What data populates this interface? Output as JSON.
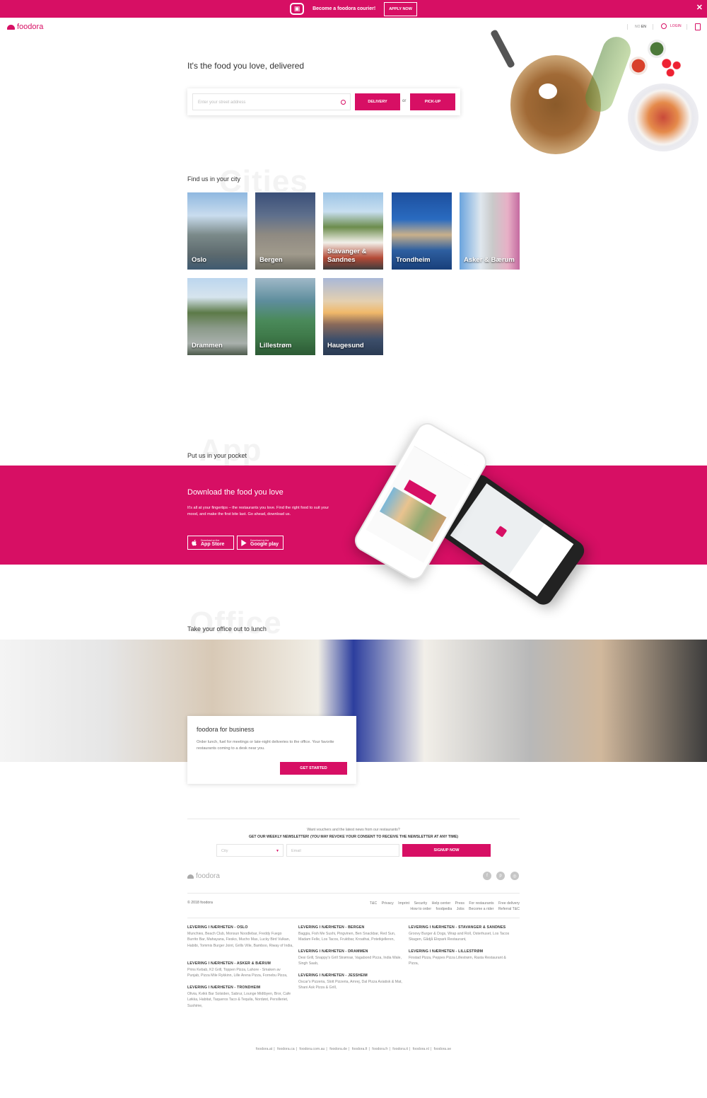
{
  "banner": {
    "text": "Become a foodora courier!",
    "apply_label": "APPLY NOW",
    "close_symbol": "✕"
  },
  "header": {
    "logo": "foodora",
    "lang_no": "NO",
    "lang_en": "EN",
    "login": "LOGIN"
  },
  "hero": {
    "title": "It's the food you love, delivered",
    "address_placeholder": "Enter your street address",
    "delivery_label": "DELIVERY",
    "or_label": "or",
    "pickup_label": "PICK-UP"
  },
  "cities": {
    "bg_word": "Cities",
    "title": "Find us in your city",
    "items": [
      {
        "name": "Oslo"
      },
      {
        "name": "Bergen"
      },
      {
        "name": "Stavanger & Sandnes"
      },
      {
        "name": "Trondheim"
      },
      {
        "name": "Asker & Bærum"
      },
      {
        "name": "Drammen"
      },
      {
        "name": "Lillestrøm"
      },
      {
        "name": "Haugesund"
      }
    ]
  },
  "app": {
    "bg_word": "App",
    "title": "Put us in your pocket",
    "headline": "Download the food you love",
    "description": "It's all at your fingertips – the restaurants you love. Find the right food to suit your mood, and make the first bite last. Go ahead, download us.",
    "appstore_small": "Download on the",
    "appstore_big": "App Store",
    "googleplay_small": "Download on the",
    "googleplay_big": "Google play"
  },
  "office": {
    "bg_word": "Office",
    "title": "Take your office out to lunch",
    "card_title": "foodora for business",
    "card_desc": "Order lunch, fuel for meetings or late-night deliveries to the office. Your favorite restaurants coming to a desk near you.",
    "card_button": "GET STARTED"
  },
  "newsletter": {
    "question": "Want vouchers and the latest news from our restaurants?",
    "headline": "GET OUR WEEKLY NEWSLETTER! (YOU MAY REVOKE YOUR CONSENT TO RECEIVE THE NEWSLETTER AT ANY TIME)",
    "city_placeholder": "City",
    "email_placeholder": "Email",
    "signup_label": "SIGNUP NOW"
  },
  "footer": {
    "logo": "foodora",
    "copyright": "© 2018 foodora",
    "links_row1": [
      "T&C",
      "Privacy",
      "Imprint",
      "Security",
      "Help center",
      "Press",
      "For restaurants",
      "Free delivery"
    ],
    "links_row2": [
      "How to order",
      "foodpedia",
      "Jobs",
      "Become a rider",
      "Referral T&C"
    ],
    "delivery_areas": [
      {
        "title": "LEVERING I NÆRHETEN - OSLO",
        "text": "Munchies, Beach Club, Monsun Noodlebar, Freddy Fuego Burrito Bar, Mahayana, Fiesko, Mucho Mas, Lucky Bird Vulkan, Habibi, Tommis Burger Joint, Grills Ville, Bamboo, Riway of India,"
      },
      {
        "title": "LEVERING I NÆRHETEN - BERGEN",
        "text": "Baggia, Fish Me Sushi, Pingvinen, Ben Snackbar, Red Sun, Madam Felle, Los Tacos, Fruktbar, Kroathai, Potetkjelleren,"
      },
      {
        "title": "LEVERING I NÆRHETEN - STAVANGER & SANDNES",
        "text": "Groovy Burger & Dogs, Wrap and Roll, Osterhuset, Los Tacos Skagen, Gådjå Elopark Restaurant,"
      },
      {
        "title": "LEVERING I NÆRHETEN - ASKER & BÆRUM",
        "text": "Prins Kebab, K2 Grill, Toppen Pizza, Lahore - Smaken av Punjab, Pizza Mile Rykkinn, Lille Arena Pizza, Fornebu Pizza,"
      },
      {
        "title": "LEVERING I NÆRHETEN - DRAMMEN",
        "text": "Desi Grill, Snappy's Grill Strømsø, Vagabond Pizza, India Wale, Singh Saab,"
      },
      {
        "title": "LEVERING I NÆRHETEN - LILLESTRØM",
        "text": "Finstad Pizza, Peppes Pizza Lillestrøm, Rasta Restaurant & Pizza,"
      },
      {
        "title": "LEVERING I NÆRHETEN - TRONDHEIM",
        "text": "Olivia, Kvikk Bar Solsiden, Sabrur, Lounge Midtbyen, Bror, Cafe Løkka, Habitat, Taqueros Taco & Tequila, Nordøst, Persilleriet, Sushime,"
      },
      {
        "title": "LEVERING I NÆRHETEN - JESSHEIM",
        "text": "Oscar's Pizzeria, Slott Pizzeria, Amrej, Dal Pizza Asiatisk & Mat, Shani Ask Pizza & Grill,"
      }
    ],
    "country_links": [
      "foodora.at",
      "foodora.ca",
      "foodora.com.au",
      "foodora.de",
      "foodora.fi",
      "foodora.fr",
      "foodora.it",
      "foodora.nl",
      "foodora.se"
    ]
  }
}
